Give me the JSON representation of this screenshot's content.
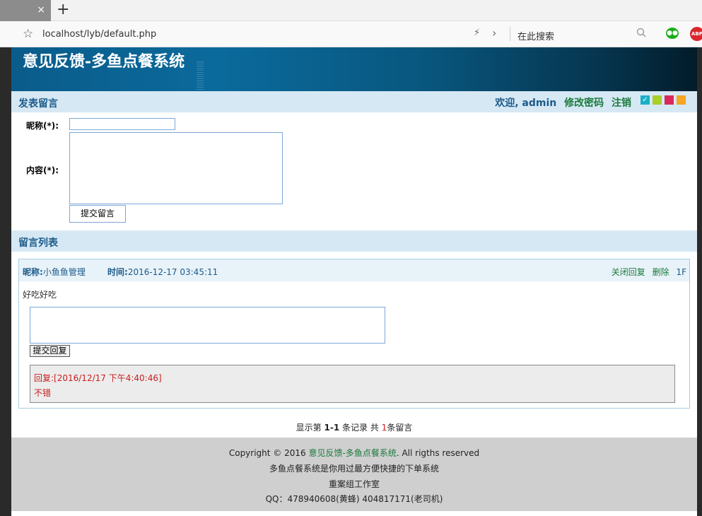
{
  "browser": {
    "close_glyph": "×",
    "newtab_glyph": "+",
    "url": "localhost/lyb/default.php",
    "search_placeholder": "在此搜索",
    "abp_label": "ABP"
  },
  "header": {
    "title": "意见反馈-多鱼点餐系统"
  },
  "post_section": {
    "title": "发表留言",
    "welcome": "欢迎, admin",
    "change_password": "修改密码",
    "logout": "注销",
    "nickname_label": "昵称(*):",
    "content_label": "内容(*):",
    "nickname_value": "",
    "content_value": "",
    "submit_label": "提交留言"
  },
  "theme_swatches": [
    "#1ab0c8",
    "#a8cf2a",
    "#d9285a",
    "#f5a623"
  ],
  "list_section": {
    "title": "留言列表",
    "messages": [
      {
        "nick_label": "昵称:",
        "nick": "小鱼鱼管理",
        "time_label": "时间:",
        "time": "2016-12-17 03:45:11",
        "close_reply": "关闭回复",
        "delete": "删除",
        "floor": "1F",
        "content": "好吃好吃",
        "reply_value": "",
        "reply_button": "提交回复",
        "reply": {
          "label": "回复:",
          "time": "[2016/12/17 下午4:40:46]",
          "content": "不错"
        }
      }
    ]
  },
  "pager": {
    "prefix": "显示第",
    "range": "1-1",
    "middle": "条记录 共",
    "total": "1",
    "suffix": "条留言"
  },
  "footer": {
    "copyright_prefix": "Copyright © 2016",
    "site_name": "意见反馈-多鱼点餐系统",
    "copyright_suffix": ". All rigths reserved",
    "line2": "多鱼点餐系统是你用过最方便快捷的下单系统",
    "line3": "重案组工作室",
    "line4": "QQ：478940608(黄蜂) 404817171(老司机)"
  }
}
